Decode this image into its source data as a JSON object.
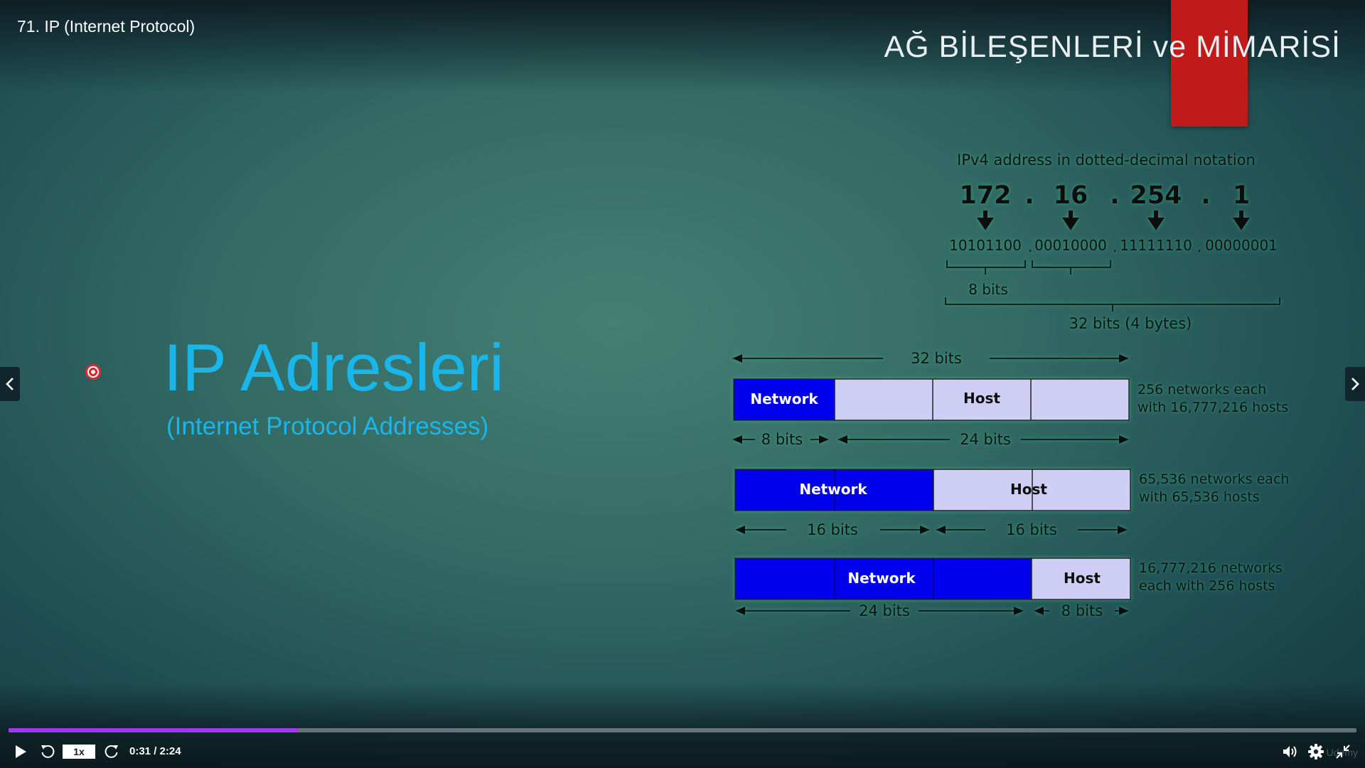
{
  "player": {
    "video_title": "71. IP (Internet Protocol)",
    "speed": "1x",
    "time": "0:31 / 2:24",
    "progress": 0.215,
    "watermark": "Udemy"
  },
  "slide": {
    "heading": "AĞ BİLEŞENLERİ ve MİMARİSİ",
    "main_title": "IP Adresleri",
    "sub_title": "(Internet Protocol Addresses)",
    "ipv4": {
      "caption": "IPv4 address in dotted-decimal notation",
      "dot": ".",
      "octets": [
        "172",
        "16",
        "254",
        "1"
      ],
      "binary": [
        "10101100",
        "00010000",
        "11111110",
        "00000001"
      ],
      "byte_label": "8 bits",
      "total_label": "32 bits (4 bytes)"
    },
    "classes": {
      "top_label": "32 bits",
      "class_a": {
        "network": "Network",
        "host": "Host",
        "desc_line1": "256 networks each",
        "desc_line2": "with 16,777,216 hosts",
        "label_left": "8 bits",
        "label_right": "24 bits"
      },
      "class_b": {
        "network": "Network",
        "host": "Host",
        "desc_line1": "65,536 networks each",
        "desc_line2": "with 65,536 hosts",
        "label_left": "16 bits",
        "label_right": "16 bits"
      },
      "class_c": {
        "network": "Network",
        "host": "Host",
        "desc_line1": "16,777,216 networks",
        "desc_line2": "each with 256 hosts",
        "label_left": "24 bits",
        "label_right": "8 bits"
      }
    }
  },
  "colors": {
    "network": "#0000ee",
    "host": "#cfcff6",
    "title_blue": "#1ab6ea",
    "accent_red": "#c01a1b",
    "progress": "#a435f0"
  },
  "icons": {
    "prev": "chevron-left-icon",
    "next": "chevron-right-icon",
    "play": "play-icon",
    "rewind": "rewind-5-icon",
    "forward": "forward-5-icon",
    "volume": "volume-icon",
    "settings": "gear-icon",
    "exit_fullscreen": "exit-fullscreen-icon"
  }
}
